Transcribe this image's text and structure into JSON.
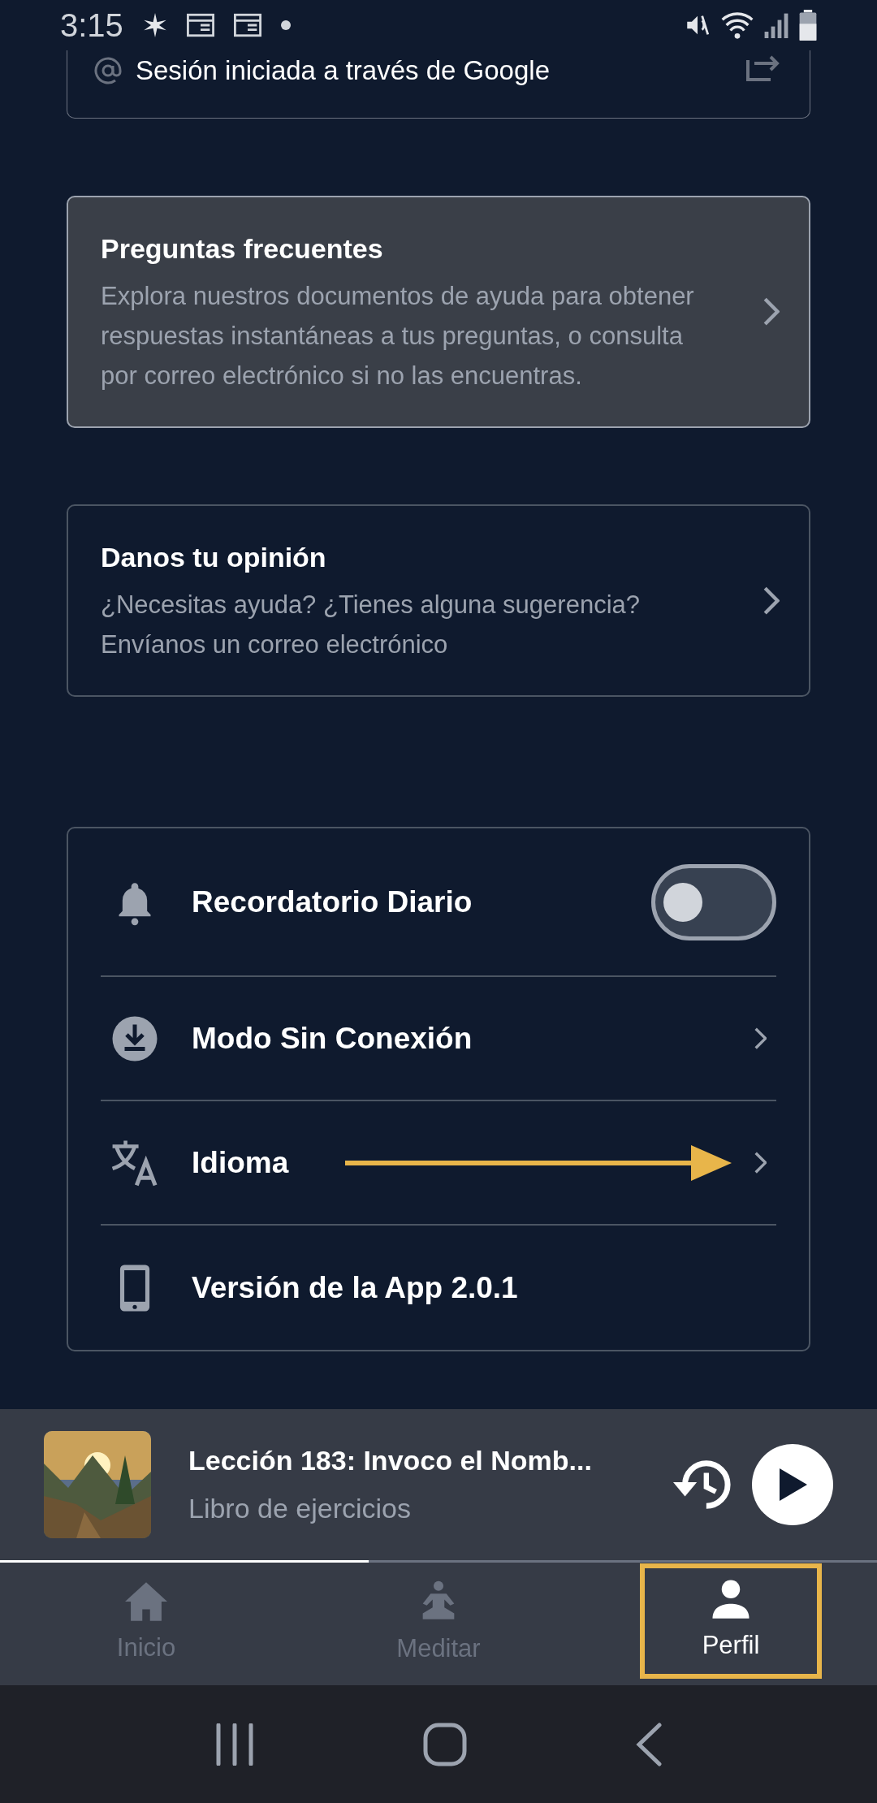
{
  "status_bar": {
    "time": "3:15"
  },
  "account": {
    "text": "Sesión iniciada a través de Google"
  },
  "cards": [
    {
      "title": "Preguntas frecuentes",
      "description": "Explora nuestros documentos de ayuda para obtener respuestas instantáneas a tus preguntas, o consulta por correo electrónico si no las encuentras.",
      "selected": true
    },
    {
      "title": "Danos tu opinión",
      "description": "¿Necesitas ayuda? ¿Tienes alguna sugerencia? Envíanos un correo electrónico",
      "selected": false
    }
  ],
  "settings": [
    {
      "kind": "toggle",
      "label": "Recordatorio Diario",
      "on": false
    },
    {
      "kind": "link",
      "label": "Modo Sin Conexión"
    },
    {
      "kind": "link",
      "label": "Idioma",
      "annotated": true
    },
    {
      "kind": "info",
      "label": "Versión de la App 2.0.1"
    }
  ],
  "player": {
    "title": "Lección 183: Invoco el Nomb...",
    "subtitle": "Libro de ejercicios",
    "level": 0.42
  },
  "nav": [
    {
      "label": "Inicio",
      "selected": false
    },
    {
      "label": "Meditar",
      "selected": false
    },
    {
      "label": "Perfil",
      "selected": true,
      "annotated": true
    }
  ]
}
